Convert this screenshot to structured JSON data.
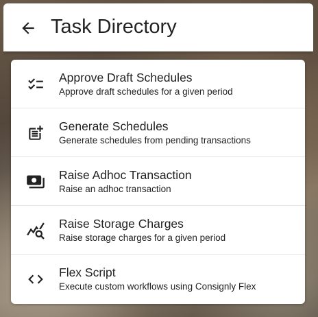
{
  "header": {
    "title": "Task Directory",
    "back_icon": "arrow-left-icon"
  },
  "tasks": [
    {
      "icon": "checklist-icon",
      "title": "Approve Draft Schedules",
      "description": "Approve draft schedules for a given period"
    },
    {
      "icon": "post-add-icon",
      "title": "Generate Schedules",
      "description": "Generate schedules from pending transactions"
    },
    {
      "icon": "payments-icon",
      "title": "Raise Adhoc Transaction",
      "description": "Raise an adhoc transaction"
    },
    {
      "icon": "query-stats-icon",
      "title": "Raise Storage Charges",
      "description": "Raise storage charges for a given period"
    },
    {
      "icon": "code-icon",
      "title": "Flex Script",
      "description": "Execute custom workflows using Consignly Flex"
    }
  ]
}
